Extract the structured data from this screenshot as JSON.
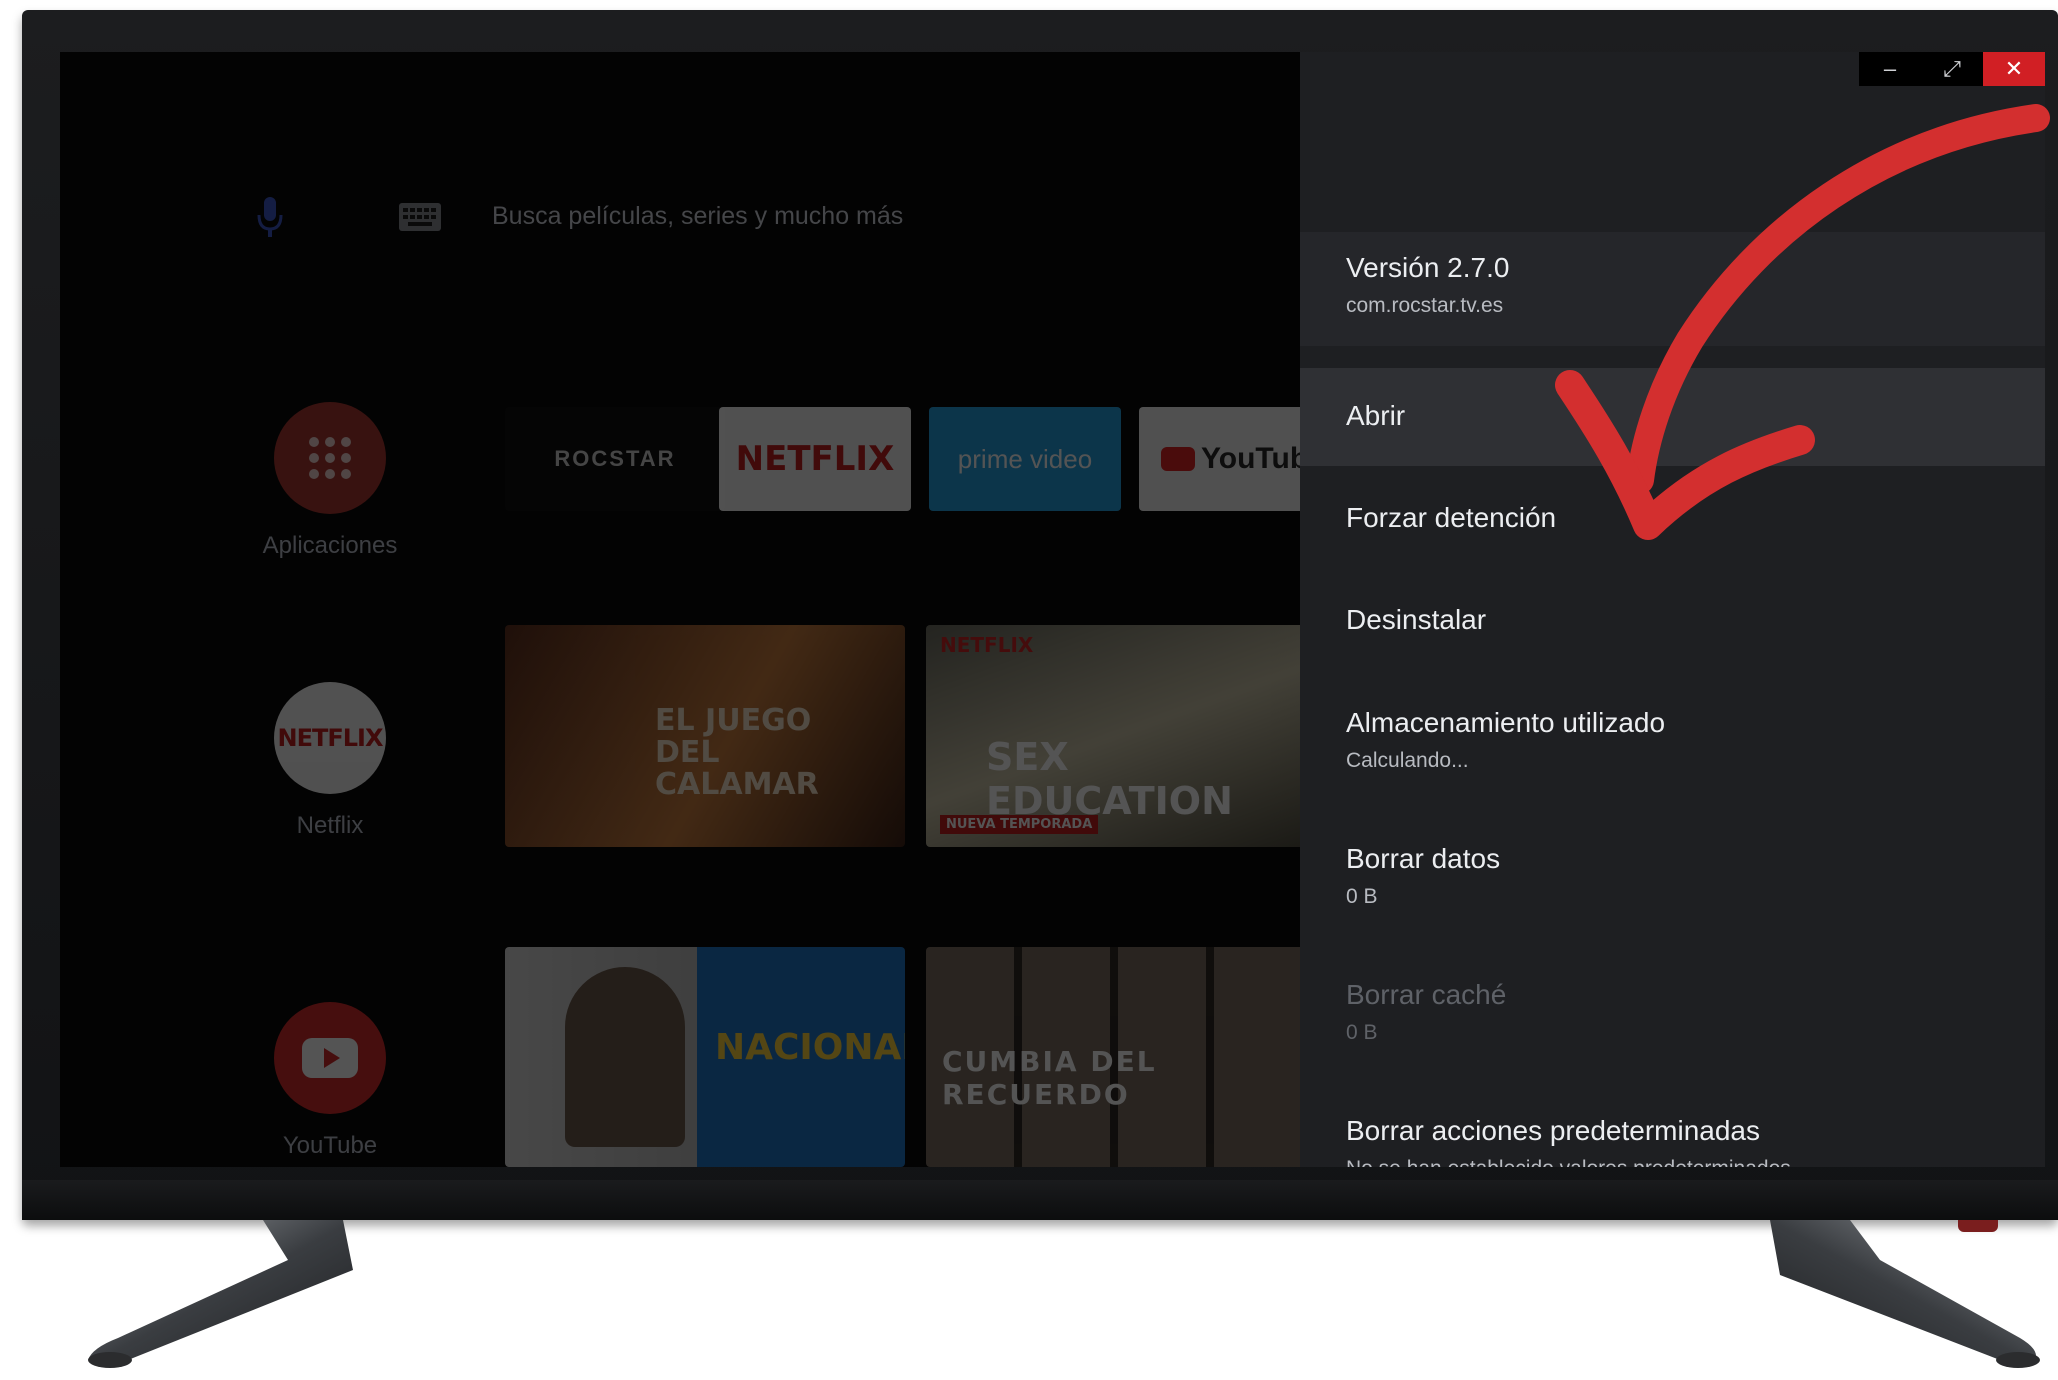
{
  "launcher": {
    "search_placeholder": "Busca películas, series y mucho más",
    "apps": [
      {
        "label": "Aplicaciones",
        "icon": "apps-grid-icon"
      },
      {
        "label": "Netflix",
        "icon": "netflix-icon",
        "logo_text": "NETFLIX"
      },
      {
        "label": "YouTube",
        "icon": "youtube-icon"
      }
    ],
    "channels": [
      {
        "label": "ROCSTAR"
      },
      {
        "label": "NETFLIX"
      },
      {
        "label": "prime video"
      },
      {
        "label": "YouTube"
      }
    ],
    "cards": [
      {
        "caption": "EL JUEGO DEL CALAMAR"
      },
      {
        "caption": "SEX EDUCATION",
        "badge": "NETFLIX",
        "sub": "NUEVA TEMPORADA"
      },
      {
        "caption": "NACIONAL"
      },
      {
        "caption": "CUMBIA DEL RECUERDO"
      }
    ]
  },
  "window_controls": {
    "minimize": "–",
    "maximize": "⤢",
    "close": "✕"
  },
  "panel": {
    "version_title": "Versión 2.7.0",
    "package": "com.rocstar.tv.es",
    "items": [
      {
        "title": "Abrir",
        "sub": "",
        "state": "selected"
      },
      {
        "title": "Forzar detención",
        "sub": "",
        "state": "enabled"
      },
      {
        "title": "Desinstalar",
        "sub": "",
        "state": "enabled"
      },
      {
        "title": "Almacenamiento utilizado",
        "sub": "Calculando...",
        "state": "enabled"
      },
      {
        "title": "Borrar datos",
        "sub": "0 B",
        "state": "enabled"
      },
      {
        "title": "Borrar caché",
        "sub": "0 B",
        "state": "disabled"
      },
      {
        "title": "Borrar acciones predeterminadas",
        "sub": "No se han establecido valores predeterminados",
        "state": "enabled"
      }
    ]
  },
  "colors": {
    "panel_bg": "#1e1f22",
    "selected_bg": "#2f3034",
    "arrow": "#d32f2f",
    "close_button": "#d11f24"
  }
}
